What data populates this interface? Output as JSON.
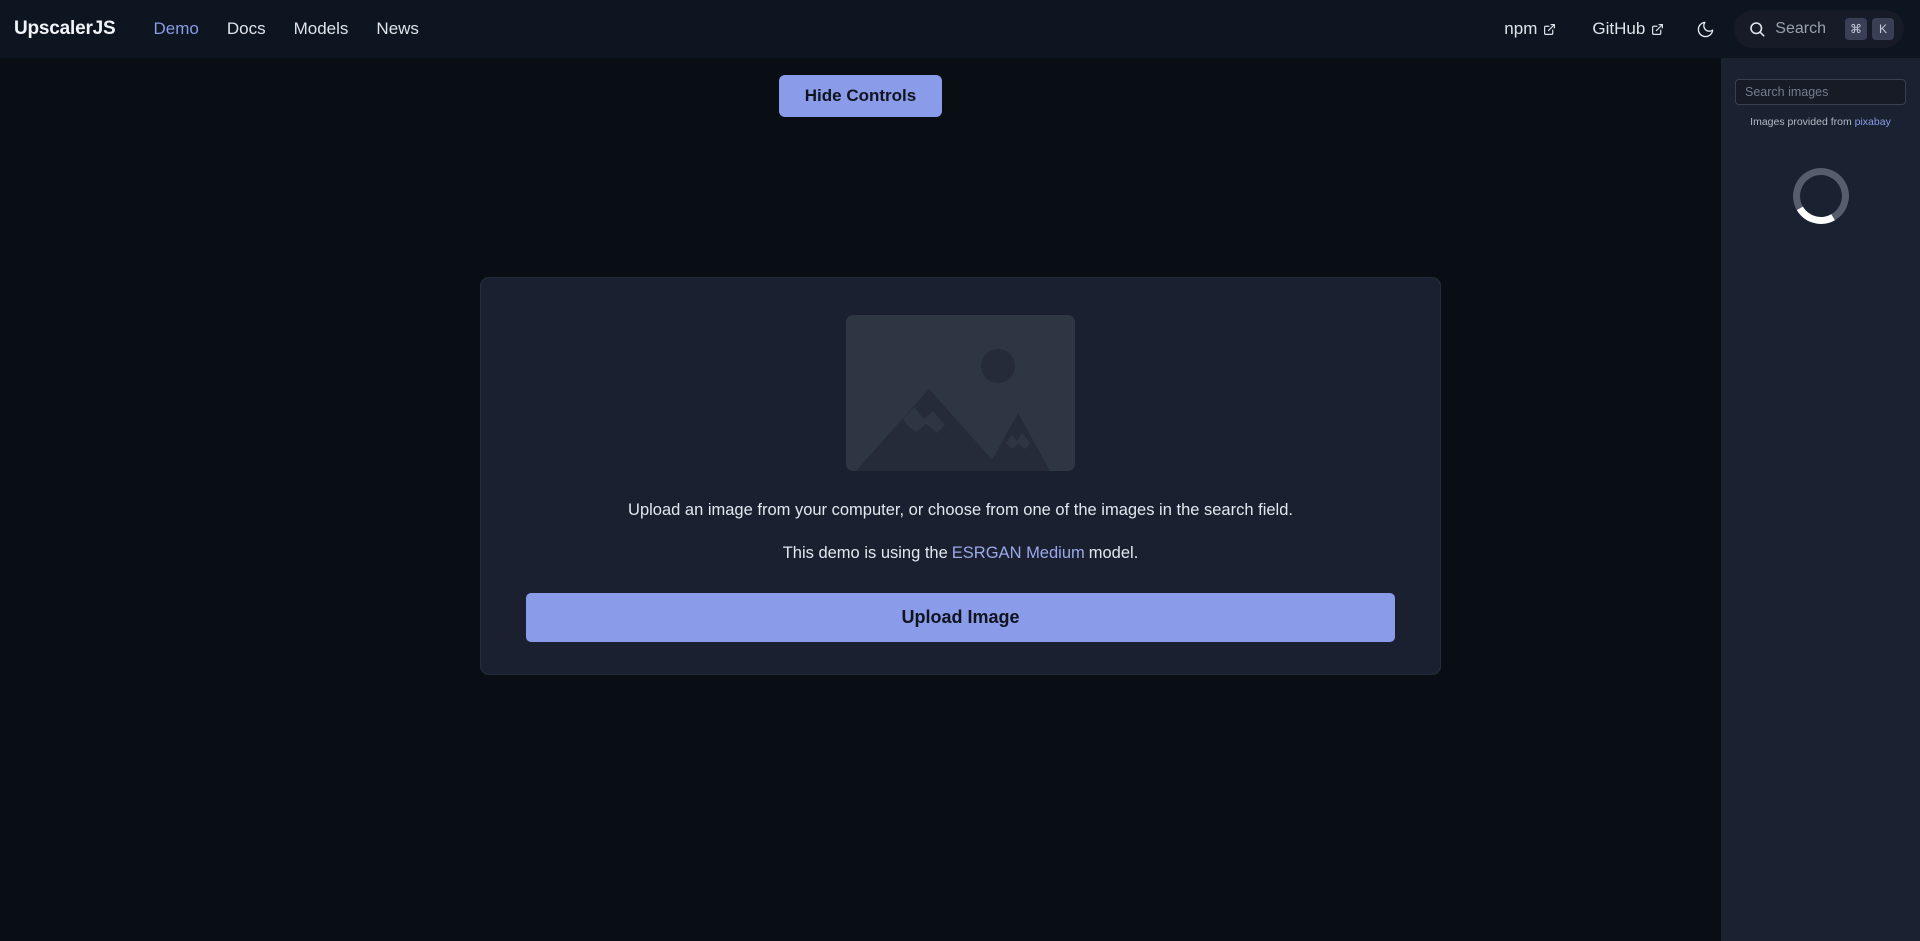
{
  "navbar": {
    "brand": "UpscalerJS",
    "links": [
      {
        "label": "Demo",
        "active": true
      },
      {
        "label": "Docs",
        "active": false
      },
      {
        "label": "Models",
        "active": false
      },
      {
        "label": "News",
        "active": false
      }
    ],
    "external": [
      {
        "label": "npm",
        "icon": "external-link-icon"
      },
      {
        "label": "GitHub",
        "icon": "external-link-icon"
      }
    ],
    "theme_toggle_icon": "moon-icon",
    "search": {
      "icon": "search-icon",
      "label": "Search",
      "shortcut_keys": [
        "⌘",
        "K"
      ]
    },
    "accent_color": "#8a9be8",
    "background_color": "#0d1520"
  },
  "main": {
    "hide_controls_label": "Hide Controls",
    "card": {
      "placeholder_icon": "image-placeholder-icon",
      "text_line_1": "Upload an image from your computer, or choose from one of the images in the search field.",
      "text_line_2_before": "This demo is using the",
      "model_link_label": "ESRGAN Medium",
      "text_line_2_after": "model.",
      "upload_button_label": "Upload Image"
    },
    "background_color": "#090d14",
    "card_background_color": "#1a2030",
    "button_color": "#8a9bea"
  },
  "sidebar": {
    "search_placeholder": "Search images",
    "search_value": "",
    "attribution_prefix": "Images provided from",
    "attribution_link": "pixabay",
    "loading_spinner": "loading-spinner-icon",
    "background_color": "#1a2130"
  }
}
